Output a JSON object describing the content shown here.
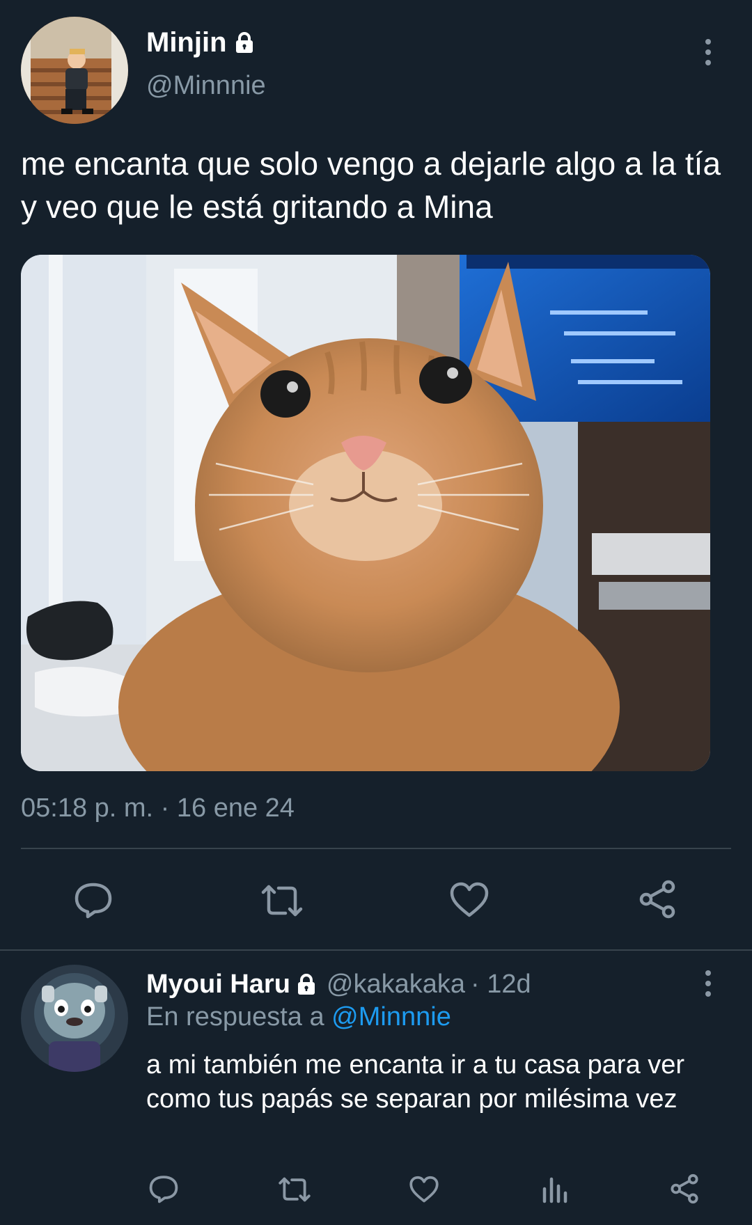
{
  "colors": {
    "background": "#15202b",
    "text": "#ffffff",
    "muted": "#8899a6",
    "link": "#1d9bf0",
    "divider": "#38444d"
  },
  "tweet": {
    "author": {
      "name": "Minjin",
      "handle": "@Minnnie",
      "protected": true
    },
    "text": "me encanta que solo vengo a dejarle algo a la tía y veo que le está gritando a Mina",
    "media": {
      "type": "photo",
      "subject": "orange-cat-selfie"
    },
    "timestamp": "05:18 p. m. · 16 ene 24",
    "actions": [
      "reply-icon",
      "retweet-icon",
      "like-icon",
      "share-icon"
    ]
  },
  "reply": {
    "author": {
      "name": "Myoui Haru",
      "handle": "@kakakaka",
      "protected": true
    },
    "age": "· 12d",
    "replying_to_prefix": "En respuesta a",
    "replying_to_handle": "@Minnnie",
    "text": "a mi también me encanta ir a tu casa para ver como tus papás se separan por milésima vez",
    "actions": [
      "reply-icon",
      "retweet-icon",
      "like-icon",
      "analytics-icon",
      "share-icon"
    ]
  }
}
